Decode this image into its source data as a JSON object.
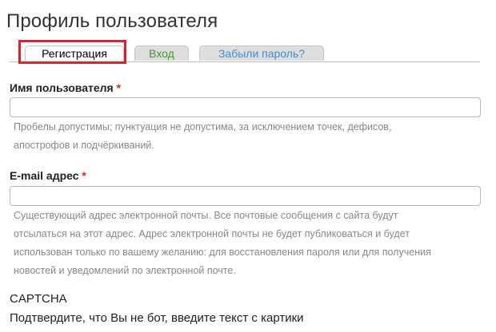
{
  "page": {
    "title": "Профиль пользователя"
  },
  "tabs": [
    {
      "label": "Регистрация"
    },
    {
      "label": "Вход"
    },
    {
      "label": "Забыли пароль?"
    }
  ],
  "form": {
    "username": {
      "label": "Имя пользователя",
      "required_marker": "*",
      "value": "",
      "help_line1": "Пробелы допустимы; пунктуация не допустима, за исключением точек, дефисов,",
      "help_line2": "апострофов и подчёркиваний."
    },
    "email": {
      "label": "E-mail адрес",
      "required_marker": "*",
      "value": "",
      "help_line1": "Существующий адрес электронной почты. Все почтовые сообщения с сайта будут",
      "help_line2": "отсылаться на этот адрес. Адрес электронной почты не будет публиковаться и будет",
      "help_line3": "использован только по вашему желанию: для восстановления пароля или для получения",
      "help_line4": "новостей и уведомлений по электронной почте."
    },
    "captcha": {
      "title": "CAPTCHA",
      "description": "Подтвердите, что Вы не бот, введите текст с картики"
    }
  },
  "colors": {
    "highlight": "#d9232a",
    "login_tab_text": "#3a9a2b",
    "forgot_tab_text": "#3d8fd3",
    "required_marker": "#d72a2a"
  }
}
